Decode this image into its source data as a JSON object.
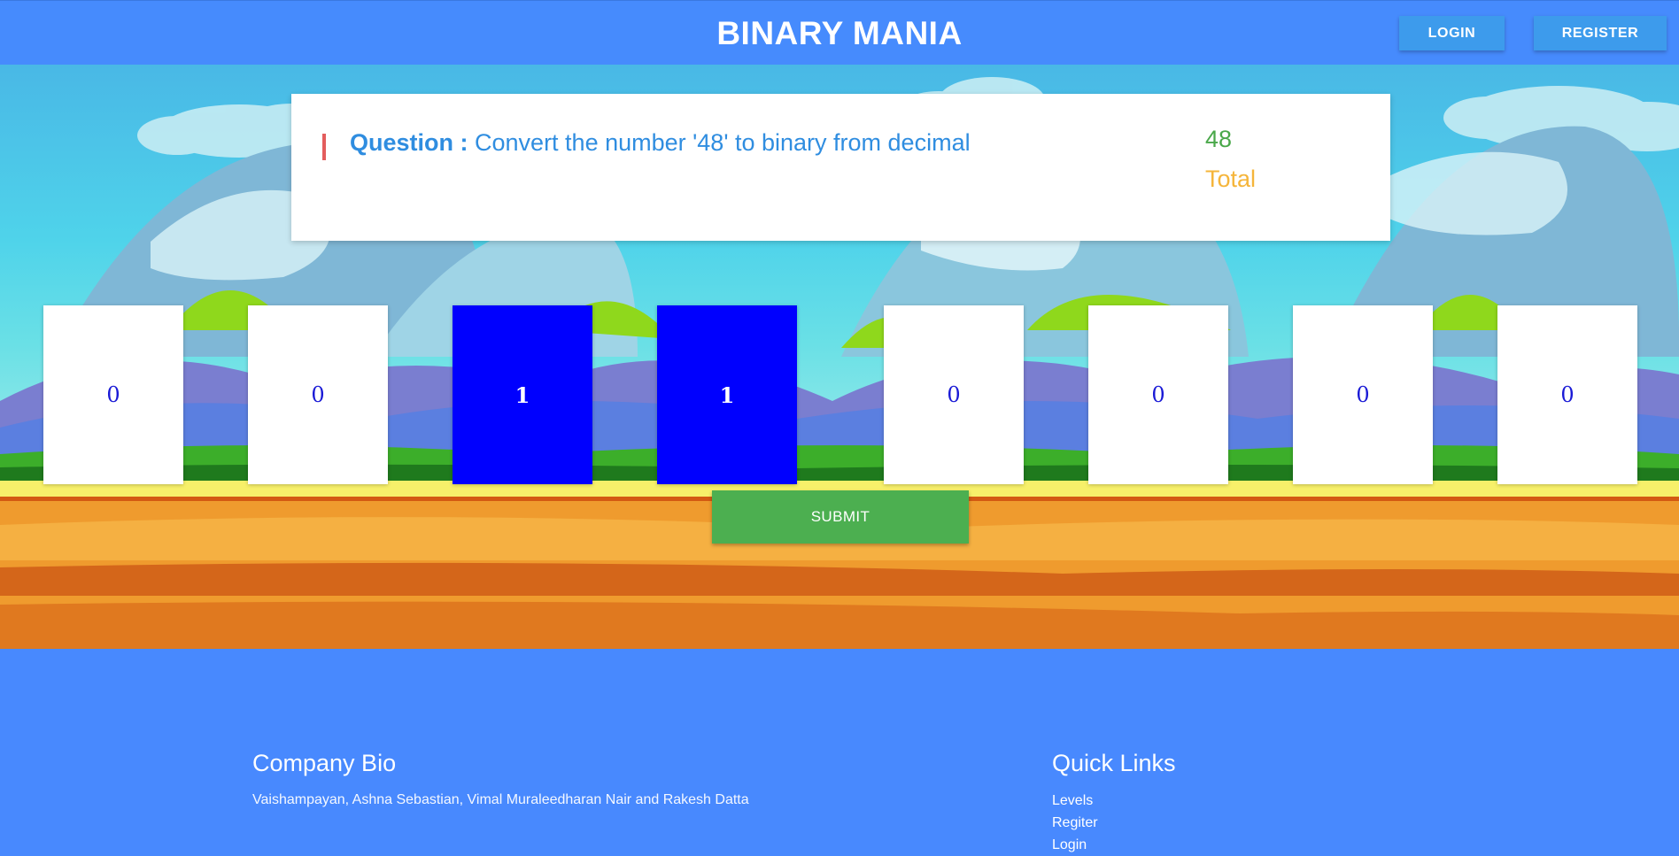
{
  "header": {
    "brand": "BINARY MANIA",
    "login_label": "LOGIN",
    "register_label": "REGISTER"
  },
  "question": {
    "label": "Question :",
    "text": "Convert the number '48' to binary from decimal",
    "number": "48",
    "total_label": "Total"
  },
  "bits": [
    {
      "value": "0",
      "active": false
    },
    {
      "value": "0",
      "active": false
    },
    {
      "value": "1",
      "active": true
    },
    {
      "value": "1",
      "active": true
    },
    {
      "value": "0",
      "active": false
    },
    {
      "value": "0",
      "active": false
    },
    {
      "value": "0",
      "active": false
    },
    {
      "value": "0",
      "active": false
    }
  ],
  "submit_label": "SUBMIT",
  "footer": {
    "bio_title": "Company Bio",
    "bio_text": "Vaishampayan, Ashna Sebastian, Vimal Muraleedharan Nair and Rakesh Datta",
    "links_title": "Quick Links",
    "links": [
      "Levels",
      "Regiter",
      "Login"
    ]
  },
  "colors": {
    "header": "#468bfd",
    "bit_active": "#0000fe",
    "bit_inactive": "#ffffff",
    "submit": "#4caf50",
    "question_text": "#2f8de0",
    "number": "#4aa84a",
    "total": "#f5b53a"
  }
}
